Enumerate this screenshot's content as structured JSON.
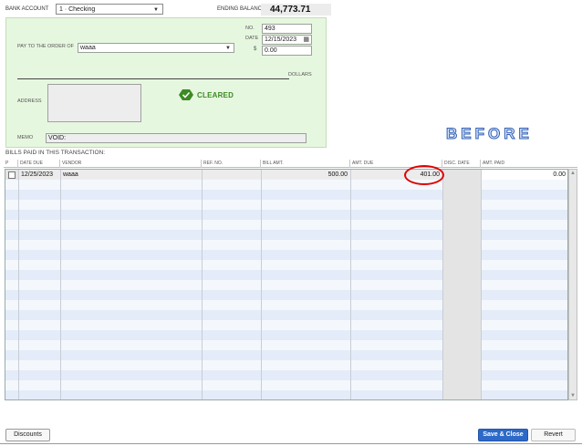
{
  "header": {
    "bank_account_label": "BANK ACCOUNT",
    "bank_account_value": "1 · Checking",
    "ending_balance_label": "ENDING BALANCE",
    "ending_balance_value": "44,773.71"
  },
  "check": {
    "no_label": "NO.",
    "no_value": "493",
    "date_label": "DATE",
    "date_value": "12/15/2023",
    "amount_symbol": "$",
    "amount_value": "0.00",
    "pay_to_label": "PAY TO THE ORDER OF",
    "pay_to_value": "waaa",
    "dollars_label": "DOLLARS",
    "address_label": "ADDRESS",
    "cleared_label": "CLEARED",
    "memo_label": "MEMO",
    "memo_value": "VOID:"
  },
  "annotation": {
    "before_text": "BEFORE",
    "ring_color": "#e00000"
  },
  "bills": {
    "title": "BILLS PAID IN THIS TRANSACTION:",
    "columns": [
      "P",
      "DATE DUE",
      "VENDOR",
      "REF. NO.",
      "BILL AMT.",
      "AMT. DUE",
      "DISC. DATE",
      "AMT. PAID"
    ],
    "rows": [
      {
        "date_due": "12/25/2023",
        "vendor": "waaa",
        "ref_no": "",
        "bill_amt": "500.00",
        "amt_due": "401.00",
        "disc_date": "",
        "amt_paid": "0.00"
      }
    ]
  },
  "buttons": {
    "discounts": "Discounts",
    "save_close": "Save & Close",
    "revert": "Revert"
  },
  "colors": {
    "check_bg": "#e6f7df",
    "cleared_green": "#3b8a23",
    "save_blue": "#2d69c8",
    "row_blue": "#e3ecf8",
    "row_gray": "#e4e4e4"
  }
}
